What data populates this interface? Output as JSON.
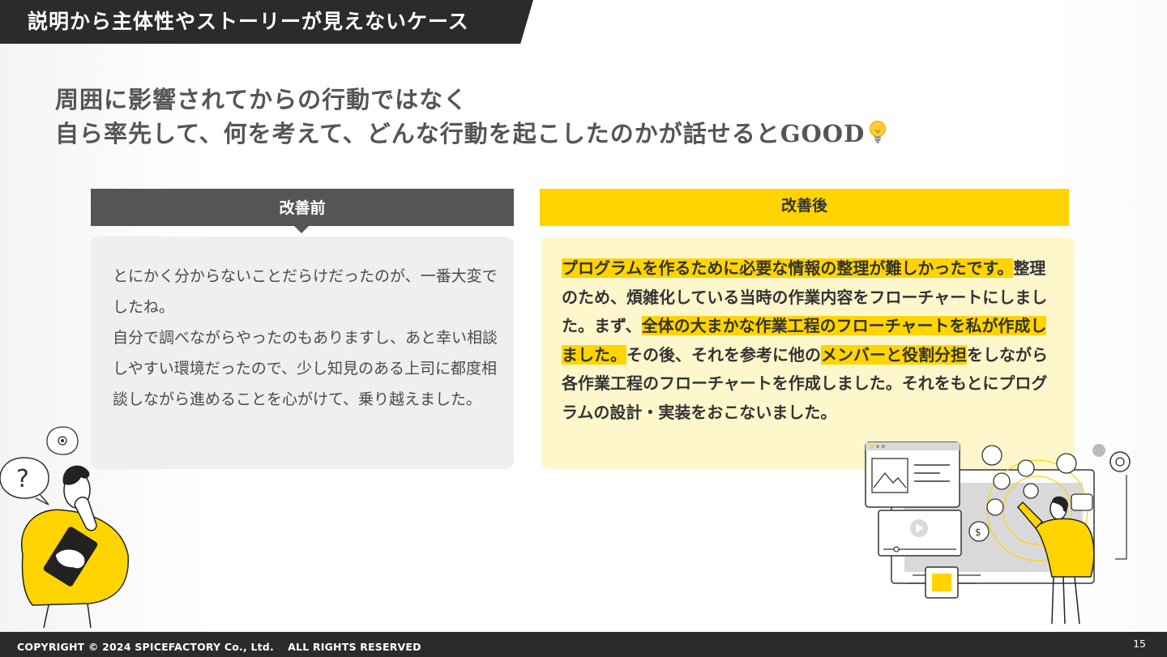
{
  "header": {
    "title": "説明から主体性やストーリーが見えないケース"
  },
  "headline": {
    "line1": "周囲に影響されてからの行動ではなく",
    "line2": "自ら率先して、何を考えて、どんな行動を起こしたのかが話せるとGOOD",
    "bulb_icon": "lightbulb-icon"
  },
  "before": {
    "label": "改善前",
    "paragraph1": "とにかく分からないことだらけだったのが、一番大変でしたね。",
    "paragraph2": "自分で調べながらやったのもありますし、あと幸い相談しやすい環境だったので、少し知見のある上司に都度相談しながら進めることを心がけて、乗り越えました。"
  },
  "after": {
    "label": "改善後",
    "segments": [
      "プログラムを作るために必要な情報の整理が難しかったです。",
      "整理のため、煩雑化している当時の作業内容をフローチャートにしました。まず、",
      "全体の大まかな作業工程のフローチャートを私が作成しました。",
      "その後、それを参考に他の",
      "メンバーと役割分担",
      "をしながら各作業工程のフローチャートを作成しました。それをもとにプログラムの設計・実装をおこないました。"
    ]
  },
  "footer": {
    "copyright": "COPYRIGHT © 2024 SPICEFACTORY Co., Ltd.　 ALL RIGHTS RESERVED",
    "page_number": "15"
  },
  "colors": {
    "accent": "#ffd400",
    "dark": "#2b2b2b",
    "gray_header": "#555555",
    "before_bg": "#efefef",
    "after_bg": "#fff7cc"
  }
}
